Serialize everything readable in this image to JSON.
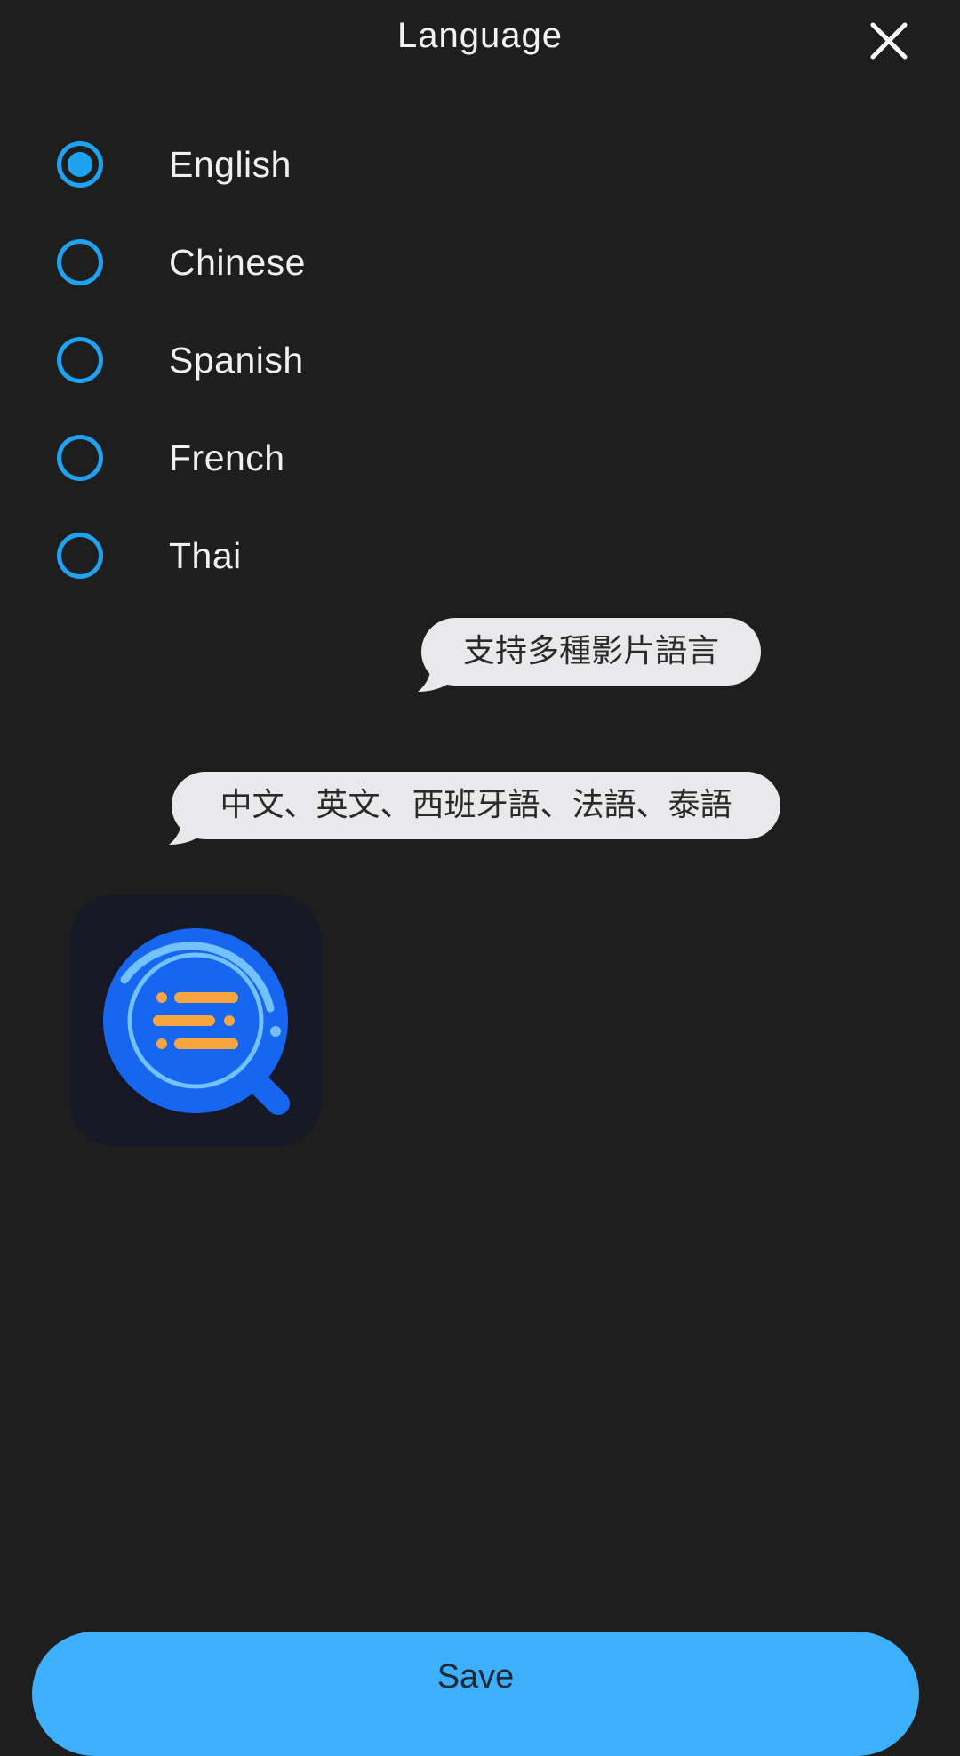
{
  "header": {
    "title": "Language",
    "close_icon": "close-icon"
  },
  "language_options": [
    {
      "label": "English",
      "selected": true
    },
    {
      "label": "Chinese",
      "selected": false
    },
    {
      "label": "Spanish",
      "selected": false
    },
    {
      "label": "French",
      "selected": false
    },
    {
      "label": "Thai",
      "selected": false
    }
  ],
  "bubbles": [
    {
      "text": "支持多種影片語言"
    },
    {
      "text": "中文、英文、西班牙語、法語、泰語"
    }
  ],
  "app_logo": {
    "icon": "magnifier-list-icon"
  },
  "footer": {
    "save_label": "Save"
  },
  "colors": {
    "background": "#1e1e1e",
    "accent": "#1fa3f0",
    "button": "#3eb0fb",
    "bubble": "#e9e9ec",
    "logo_blue": "#1766f0",
    "logo_orange": "#f7a441"
  }
}
